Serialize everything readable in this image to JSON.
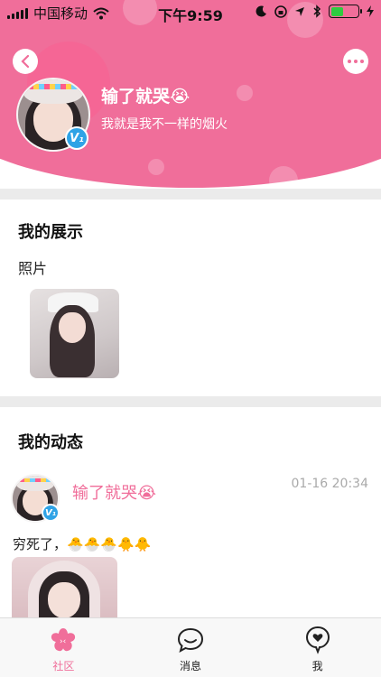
{
  "status_bar": {
    "carrier": "中国移动",
    "time": "下午9:59"
  },
  "profile": {
    "name": "输了就哭😭",
    "signature": "我就是我不一样的烟火",
    "level_badge": "V₁"
  },
  "showcase": {
    "title": "我的展示",
    "photos_label": "照片"
  },
  "feed": {
    "title": "我的动态",
    "post": {
      "author": "输了就哭😭",
      "time": "01-16 20:34",
      "text": "穷死了，🐣🐣🐣🐥🐥",
      "level_badge": "V₁"
    }
  },
  "tabbar": {
    "tabs": [
      {
        "label": "社区",
        "icon": "community-flower-icon",
        "active": true
      },
      {
        "label": "消息",
        "icon": "message-bubble-icon",
        "active": false
      },
      {
        "label": "我",
        "icon": "me-heart-icon",
        "active": false
      }
    ]
  },
  "colors": {
    "accent": "#f06e9a",
    "badge_blue": "#2fa3e6",
    "divider": "#ebebeb"
  }
}
